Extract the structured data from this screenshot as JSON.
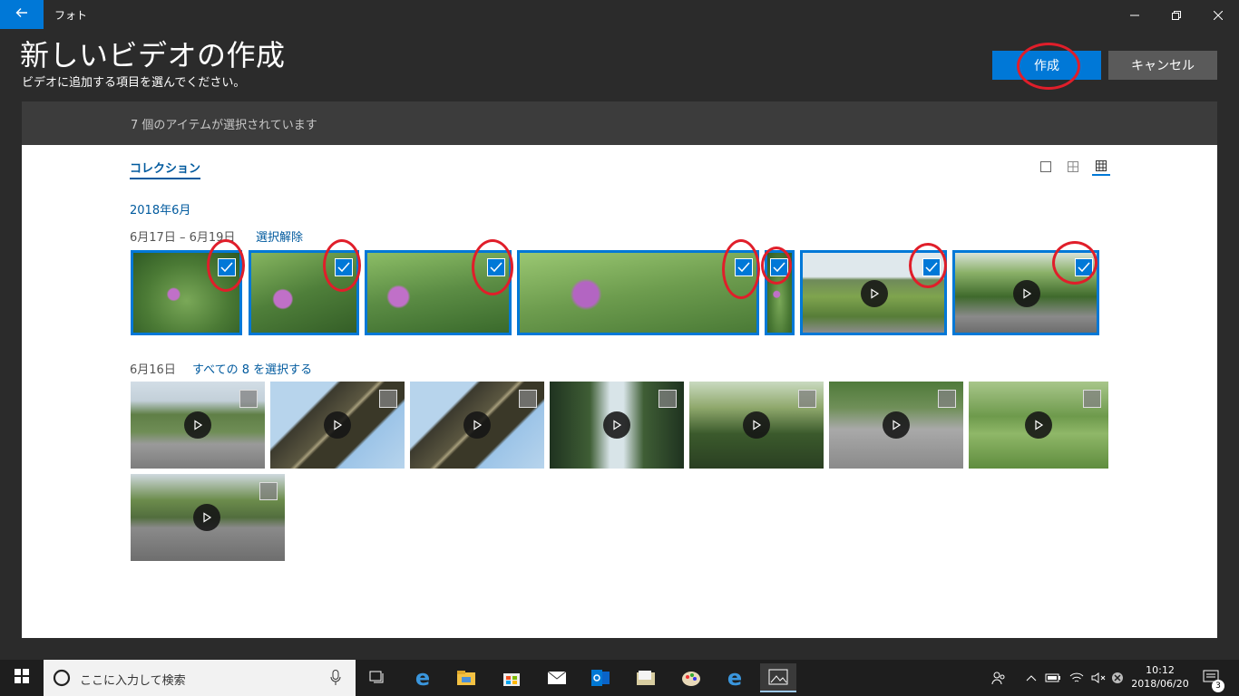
{
  "titlebar": {
    "app_name": "フォト",
    "back_icon": "arrow-left-icon",
    "controls": [
      "minimize-icon",
      "restore-icon",
      "close-icon"
    ]
  },
  "header": {
    "title": "新しいビデオの作成",
    "subtitle": "ビデオに追加する項目を選んでください。",
    "create_label": "作成",
    "cancel_label": "キャンセル"
  },
  "selection_bar": {
    "text": "7 個のアイテムが選択されています"
  },
  "collection": {
    "tab_label": "コレクション",
    "view_modes": [
      "single-view-icon",
      "grid-view-icon",
      "dense-grid-view-icon"
    ],
    "month": "2018年6月",
    "groups": [
      {
        "date_label": "6月17日 – 6月19日",
        "action_label": "選択解除",
        "items": [
          {
            "type": "photo",
            "selected": true
          },
          {
            "type": "photo",
            "selected": true
          },
          {
            "type": "photo",
            "selected": true
          },
          {
            "type": "photo",
            "selected": true
          },
          {
            "type": "photo",
            "selected": true
          },
          {
            "type": "video",
            "selected": true
          },
          {
            "type": "video",
            "selected": true
          }
        ]
      },
      {
        "date_label": "6月16日",
        "action_label": "すべての 8 を選択する",
        "items": [
          {
            "type": "video",
            "selected": false
          },
          {
            "type": "video",
            "selected": false
          },
          {
            "type": "video",
            "selected": false
          },
          {
            "type": "video",
            "selected": false
          },
          {
            "type": "video",
            "selected": false
          },
          {
            "type": "video",
            "selected": false
          },
          {
            "type": "video",
            "selected": false
          },
          {
            "type": "video",
            "selected": false
          }
        ]
      }
    ]
  },
  "annotation_color": "#e01e2a",
  "accent_color": "#0078d7",
  "taskbar": {
    "search_placeholder": "ここに入力して検索",
    "apps": [
      "task-view-icon",
      "edge-icon",
      "file-explorer-icon",
      "store-icon",
      "mail-icon",
      "outlook-icon",
      "folder-icon",
      "paint-icon",
      "edge-icon",
      "photos-icon"
    ],
    "time": "10:12",
    "date": "2018/06/20",
    "notification_count": "3"
  }
}
